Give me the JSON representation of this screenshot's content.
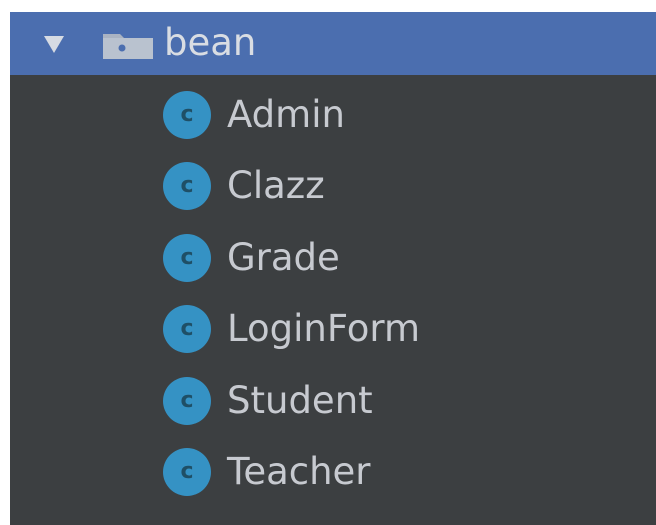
{
  "project_tree": {
    "folder": {
      "name": "bean",
      "expanded": true,
      "expand_icon": "triangle-down",
      "icon": "folder-package"
    },
    "classes": [
      {
        "name": "Admin",
        "icon_letter": "c"
      },
      {
        "name": "Clazz",
        "icon_letter": "c"
      },
      {
        "name": "Grade",
        "icon_letter": "c"
      },
      {
        "name": "LoginForm",
        "icon_letter": "c"
      },
      {
        "name": "Student",
        "icon_letter": "c"
      },
      {
        "name": "Teacher",
        "icon_letter": "c"
      }
    ]
  },
  "colors": {
    "panel_background": "#3c3f41",
    "selection_background": "#4b6eaf",
    "class_icon": "#3592c4"
  }
}
